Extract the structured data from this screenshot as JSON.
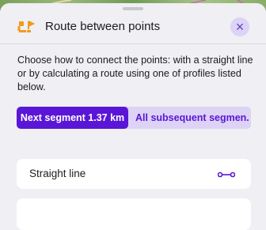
{
  "header": {
    "title": "Route between points"
  },
  "description": "Choose how to connect the points: with a straight line or by calculating a route using one of profiles listed below.",
  "segment_control": {
    "active_label": "Next segment 1.37 km",
    "inactive_label": "All subsequent segmen..."
  },
  "options": [
    {
      "label": "Straight line",
      "icon": "straight-line-icon"
    },
    {
      "label": "",
      "icon": ""
    }
  ],
  "colors": {
    "accent": "#5a16d6",
    "accent_light": "#ddd3f5",
    "route_icon_orange": "#f29a1d",
    "background": "#efeff4"
  }
}
